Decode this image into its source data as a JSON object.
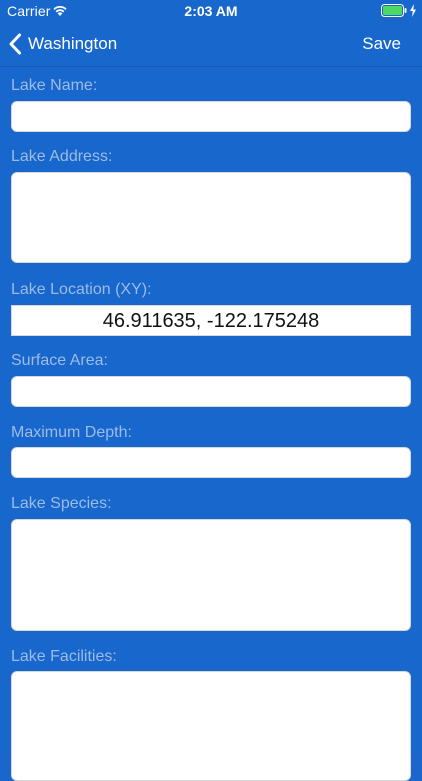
{
  "status_bar": {
    "carrier": "Carrier",
    "time": "2:03 AM",
    "battery_color": "#4cd964",
    "icons": [
      "wifi-icon",
      "battery-icon",
      "charging-bolt-icon"
    ]
  },
  "nav": {
    "back_label": "Washington",
    "save_label": "Save",
    "back_icon": "chevron-left-icon"
  },
  "form": {
    "lake_name": {
      "label": "Lake Name:",
      "value": ""
    },
    "lake_address": {
      "label": "Lake Address:",
      "value": ""
    },
    "lake_location": {
      "label": "Lake Location (XY):",
      "value": "46.911635, -122.175248"
    },
    "surface_area": {
      "label": "Surface Area:",
      "value": ""
    },
    "maximum_depth": {
      "label": "Maximum Depth:",
      "value": ""
    },
    "lake_species": {
      "label": "Lake Species:",
      "value": ""
    },
    "lake_facilities": {
      "label": "Lake Facilities:",
      "value": ""
    }
  },
  "colors": {
    "background": "#1767cc",
    "label": "#9dbbe6",
    "field": "#ffffff"
  }
}
